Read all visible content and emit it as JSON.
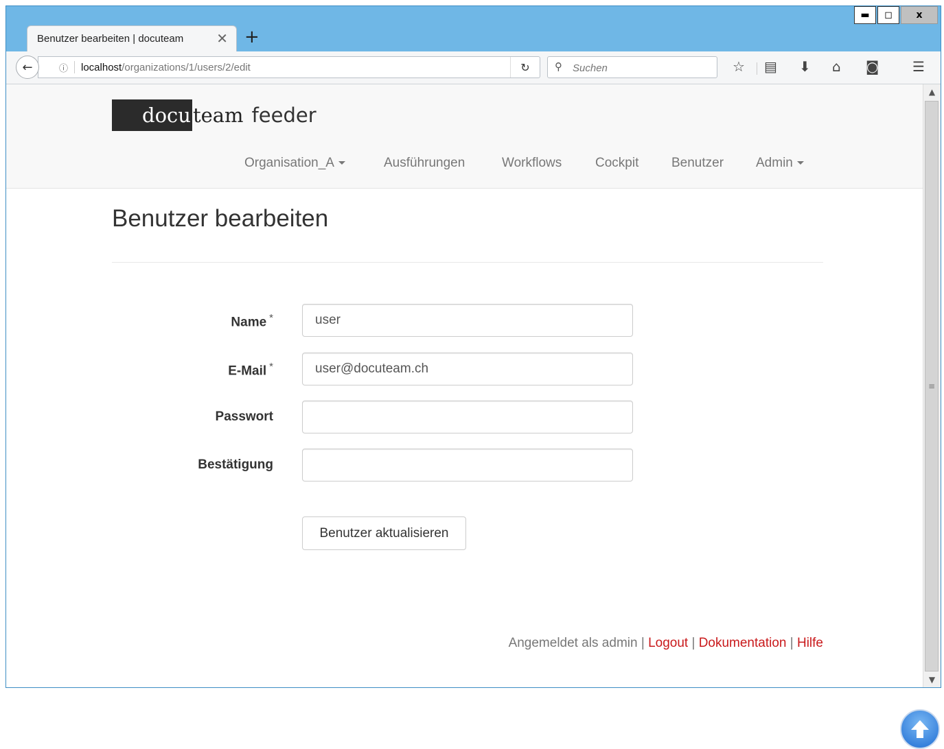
{
  "browser": {
    "tab_title": "Benutzer bearbeiten | docuteam",
    "new_tab_label": "+",
    "tab_close_label": "✕",
    "window_controls": {
      "minimize": "▬",
      "maximize": "◻",
      "close": "x"
    },
    "url_host": "localhost",
    "url_path": "/organizations/1/users/2/edit",
    "search_placeholder": "Suchen",
    "icons": [
      "back-icon",
      "info-icon",
      "reload-icon",
      "search-icon",
      "bookmark-star-icon",
      "reading-list-icon",
      "download-icon",
      "home-icon",
      "pocket-icon",
      "menu-icon"
    ]
  },
  "site": {
    "logo_dark": "docu",
    "logo_team": "team",
    "logo_feeder": "feeder",
    "nav": {
      "organisation": "Organisation_A",
      "executions": "Ausführungen",
      "workflows": "Workflows",
      "cockpit": "Cockpit",
      "users": "Benutzer",
      "admin": "Admin"
    }
  },
  "page": {
    "title": "Benutzer bearbeiten",
    "form": {
      "name_label": "Name",
      "name_value": "user",
      "email_label": "E-Mail",
      "email_value": "user@docuteam.ch",
      "password_label": "Passwort",
      "password_value": "",
      "confirmation_label": "Bestätigung",
      "confirmation_value": "",
      "required_marker": "*",
      "submit_label": "Benutzer aktualisieren"
    }
  },
  "footer": {
    "logged_in_as": "Angemeldet als admin",
    "separator": "|",
    "logout": "Logout",
    "documentation": "Dokumentation",
    "help": "Hilfe"
  },
  "colors": {
    "accent": "#c9191b",
    "window_frame": "#6fb7e6"
  }
}
